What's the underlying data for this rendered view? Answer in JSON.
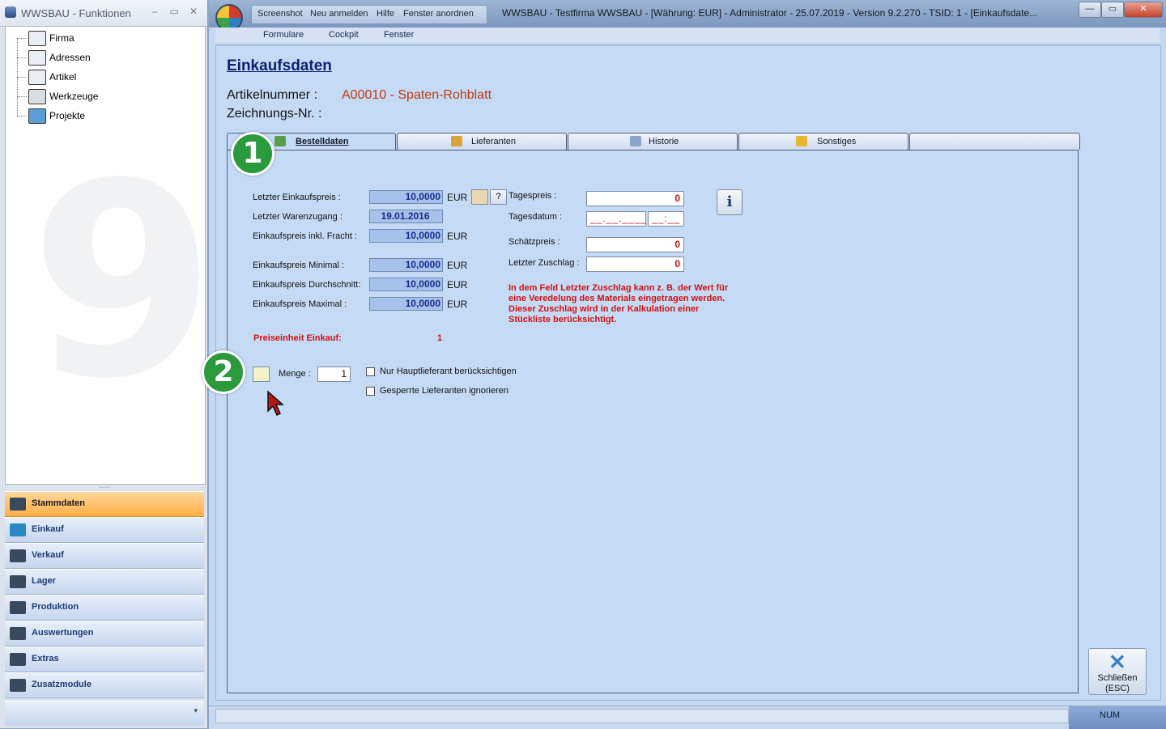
{
  "left_window": {
    "title": "WWSBAU - Funktionen",
    "controls": {
      "minimize": "–",
      "maximize": "▭",
      "close": "✕"
    },
    "tree": [
      {
        "label": "Firma",
        "icon": "factory-icon"
      },
      {
        "label": "Adressen",
        "icon": "address-card-icon"
      },
      {
        "label": "Artikel",
        "icon": "box-icon"
      },
      {
        "label": "Werkzeuge",
        "icon": "tools-icon"
      },
      {
        "label": "Projekte",
        "icon": "project-icon"
      }
    ],
    "splitter": "......",
    "nav": [
      {
        "label": "Stammdaten",
        "icon": "master-data-icon",
        "active": true
      },
      {
        "label": "Einkauf",
        "icon": "cart-icon"
      },
      {
        "label": "Verkauf",
        "icon": "cash-register-icon"
      },
      {
        "label": "Lager",
        "icon": "warehouse-icon"
      },
      {
        "label": "Produktion",
        "icon": "production-icon"
      },
      {
        "label": "Auswertungen",
        "icon": "analysis-icon"
      },
      {
        "label": "Extras",
        "icon": "extras-icon"
      },
      {
        "label": "Zusatzmodule",
        "icon": "modules-icon"
      }
    ],
    "nav_more": "▾"
  },
  "main_window": {
    "quick_access": [
      "Screenshot",
      "Neu anmelden",
      "Hilfe",
      "Fenster anordnen"
    ],
    "title": "WWSBAU - Testfirma WWSBAU - [Währung: EUR] - Administrator - 25.07.2019 - Version 9.2.270 - TSID: 1 - [Einkaufsdate...",
    "controls": {
      "minimize": "—",
      "maximize": "▭",
      "close": "✕"
    },
    "menu": [
      "Formulare",
      "Cockpit",
      "Fenster"
    ]
  },
  "page": {
    "title": "Einkaufsdaten",
    "artikelnummer_label": "Artikelnummer :",
    "artikelnummer_value": "A00010 - Spaten-Rohblatt",
    "zeichnungsnr_label": "Zeichnungs-Nr. :"
  },
  "tabs": [
    {
      "label": "Bestelldaten",
      "active": true,
      "icon": "order-icon"
    },
    {
      "label": "Lieferanten",
      "icon": "supplier-icon"
    },
    {
      "label": "Historie",
      "icon": "history-icon"
    },
    {
      "label": "Sonstiges",
      "icon": "misc-icon"
    }
  ],
  "bestelldaten": {
    "letzter_ekp_label": "Letzter Einkaufspreis :",
    "letzter_ekp_value": "10,0000",
    "letzter_wz_label": "Letzter Warenzugang :",
    "letzter_wz_value": "19.01.2016",
    "ekp_fracht_label": "Einkaufspreis inkl. Fracht :",
    "ekp_fracht_value": "10,0000",
    "ekp_min_label": "Einkaufspreis Minimal :",
    "ekp_min_value": "10,0000",
    "ekp_avg_label": "Einkaufspreis Durchschnitt:",
    "ekp_avg_value": "10,0000",
    "ekp_max_label": "Einkaufspreis Maximal :",
    "ekp_max_value": "10,0000",
    "currency": "EUR",
    "help_button": "?",
    "tagespreis_label": "Tagespreis :",
    "tagespreis_value": "0",
    "tagesdatum_label": "Tagesdatum :",
    "tagesdatum_date": "__.__.____",
    "tagesdatum_time": "__:__",
    "schaetzpreis_label": "Schätzpreis :",
    "schaetzpreis_value": "0",
    "letzter_zuschlag_label": "Letzter Zuschlag :",
    "letzter_zuschlag_value": "0",
    "note_lines": [
      "In dem Feld Letzter Zuschlag kann z. B. der Wert für",
      "eine Veredelung des Materials eingetragen werden.",
      "Dieser Zuschlag wird in der Kalkulation einer",
      "Stückliste berücksichtigt."
    ],
    "preiseinheit_label": "Preiseinheit Einkauf:",
    "preiseinheit_value": "1",
    "menge_label": "Menge :",
    "menge_value": "1",
    "nur_hauptlieferant_label": "Nur Hauptlieferant berücksichtigen",
    "gesperrte_lieferanten_label": "Gesperrte Lieferanten ignorieren"
  },
  "callouts": [
    "1",
    "2"
  ],
  "close_button": {
    "line1": "Schließen",
    "line2": "(ESC)"
  },
  "status": {
    "num": "NUM"
  }
}
